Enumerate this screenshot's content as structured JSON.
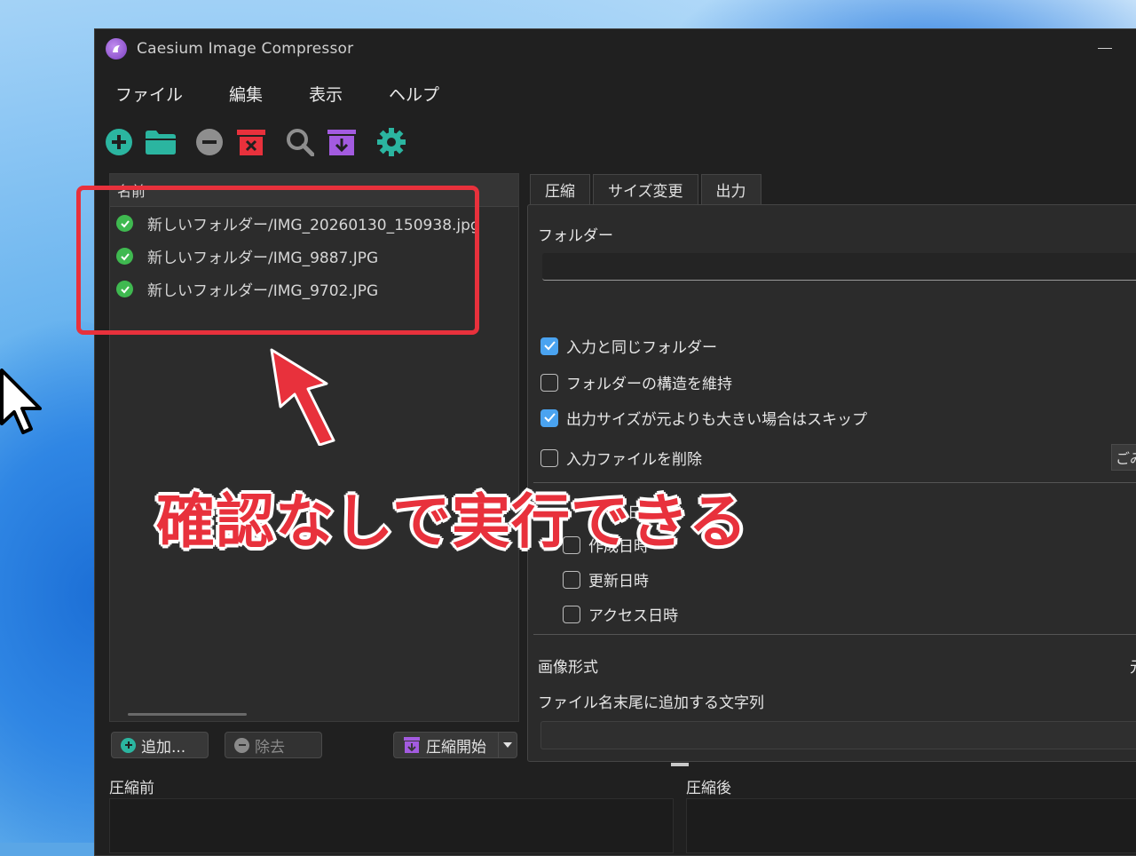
{
  "window": {
    "title": "Caesium Image Compressor"
  },
  "menu": [
    "ファイル",
    "編集",
    "表示",
    "ヘルプ"
  ],
  "toolbar_icons": [
    "add-circle-icon",
    "folder-icon",
    "remove-circle-icon",
    "clear-trash-icon",
    "search-icon",
    "export-download-icon",
    "gear-icon"
  ],
  "file_list": {
    "header": "名前",
    "items": [
      {
        "name": "新しいフォルダー/IMG_20260130_150938.jpg",
        "status": "done"
      },
      {
        "name": "新しいフォルダー/IMG_9887.JPG",
        "status": "done"
      },
      {
        "name": "新しいフォルダー/IMG_9702.JPG",
        "status": "done"
      }
    ]
  },
  "buttons": {
    "add": "追加...",
    "remove": "除去",
    "compress": "圧縮開始"
  },
  "tabs": [
    "圧縮",
    "サイズ変更",
    "出力"
  ],
  "output": {
    "folder_label": "フォルダー",
    "folder_value": "",
    "checkboxes": [
      {
        "label": "入力と同じフォルダー",
        "checked": true
      },
      {
        "label": "フォルダーの構造を維持",
        "checked": false
      },
      {
        "label": "出力サイズが元よりも大きい場合はスキップ",
        "checked": true
      },
      {
        "label": "入力ファイルを削除",
        "checked": false
      }
    ],
    "trash_button": "ごみ",
    "date_group_partial": "日",
    "date_options": [
      {
        "label": "作成日時",
        "checked": false
      },
      {
        "label": "更新日時",
        "checked": false
      },
      {
        "label": "アクセス日時",
        "checked": false
      }
    ],
    "image_format_label": "画像形式",
    "image_format_value": "元",
    "suffix_label": "ファイル名末尾に追加する文字列",
    "suffix_value": ""
  },
  "preview": {
    "before": "圧縮前",
    "after": "圧縮後"
  },
  "annotation": {
    "text": "確認なしで実行できる"
  },
  "colors": {
    "accent_green": "#2bb5a0",
    "check_green": "#3fb950",
    "red": "#e8313c",
    "purple": "#a35be0",
    "checkbox_blue": "#4aa3f0"
  }
}
